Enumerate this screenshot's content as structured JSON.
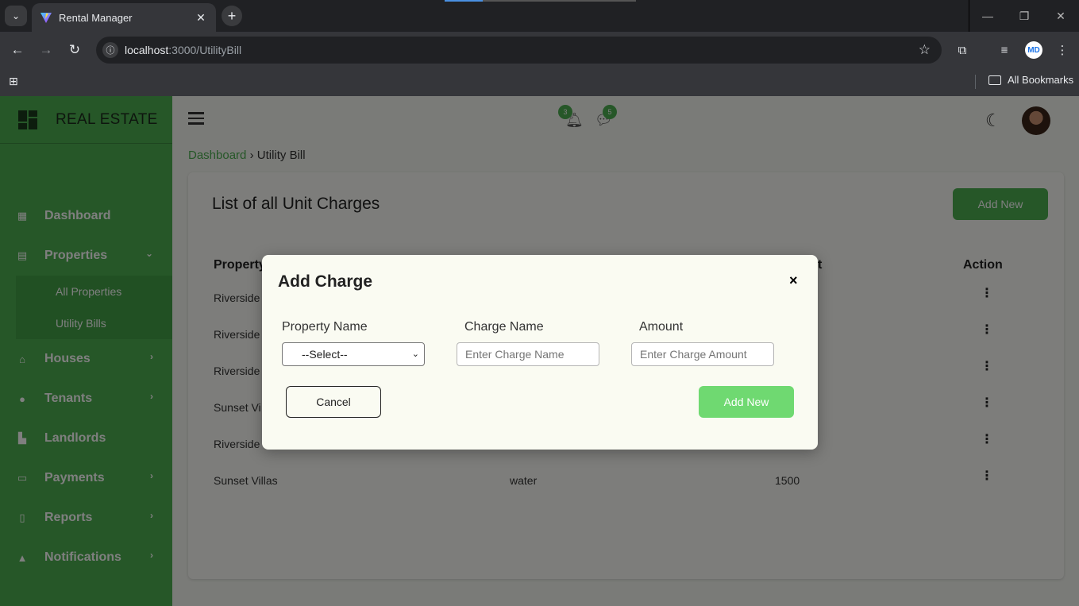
{
  "browser": {
    "tab_title": "Rental Manager",
    "url_host": "localhost",
    "url_path": ":3000/UtilityBill",
    "bookmarks_label": "All Bookmarks",
    "profile_initials": "MD"
  },
  "sidebar": {
    "brand": "REAL ESTATE",
    "items": [
      {
        "label": "Dashboard",
        "icon": "dashboard-icon"
      },
      {
        "label": "Properties",
        "icon": "building-icon",
        "expanded": true
      },
      {
        "label": "All Properties"
      },
      {
        "label": "Utility Bills"
      },
      {
        "label": "Houses",
        "icon": "home-icon"
      },
      {
        "label": "Tenants",
        "icon": "users-icon"
      },
      {
        "label": "Landlords",
        "icon": "landlord-icon"
      },
      {
        "label": "Payments",
        "icon": "card-icon"
      },
      {
        "label": "Reports",
        "icon": "report-icon"
      },
      {
        "label": "Notifications",
        "icon": "bell-icon"
      }
    ]
  },
  "topbar": {
    "notification_count": "3",
    "message_count": "5"
  },
  "breadcrumb": {
    "root": "Dashboard",
    "current": "Utility Bill"
  },
  "page": {
    "title": "List of all Unit Charges",
    "add_label": "Add New",
    "columns": [
      "Property",
      "t",
      "Action"
    ],
    "rows": [
      {
        "property": "Riverside",
        "charge": "",
        "amount": ""
      },
      {
        "property": "Riverside",
        "charge": "",
        "amount": ""
      },
      {
        "property": "Riverside",
        "charge": "",
        "amount": ""
      },
      {
        "property": "Sunset Vi",
        "charge": "",
        "amount": ""
      },
      {
        "property": "Riverside",
        "charge": "",
        "amount": ""
      },
      {
        "property": "Sunset Villas",
        "charge": "water",
        "amount": "1500"
      }
    ]
  },
  "modal": {
    "title": "Add Charge",
    "close": "×",
    "property_label": "Property Name",
    "property_value": "--Select--",
    "charge_label": "Charge Name",
    "charge_placeholder": "Enter Charge Name",
    "amount_label": "Amount",
    "amount_placeholder": "Enter Charge Amount",
    "cancel_label": "Cancel",
    "submit_label": "Add New"
  }
}
